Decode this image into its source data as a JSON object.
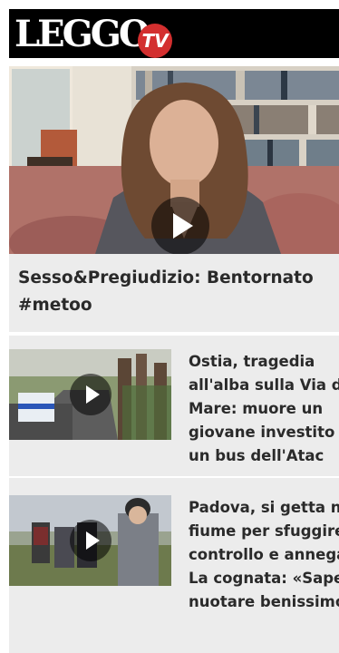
{
  "header": {
    "logo_text": "LEGGO",
    "logo_badge": "TV"
  },
  "hero": {
    "title": "Sesso&Pregiudizio: Bentornato #metoo"
  },
  "stories": [
    {
      "title": "Ostia, tragedia all'alba sulla Via del Mare: muore un giovane investito da un bus dell'Atac"
    },
    {
      "title": "Padova, si getta nel fiume per sfuggire al controllo e annega. La cognata: «Sapeva nuotare benissimo»"
    }
  ],
  "colors": {
    "header_bg": "#000000",
    "badge_red": "#d32f2f",
    "card_bg": "#ececec",
    "title_text": "#2a2a2a"
  },
  "icons": [
    "play-icon"
  ]
}
